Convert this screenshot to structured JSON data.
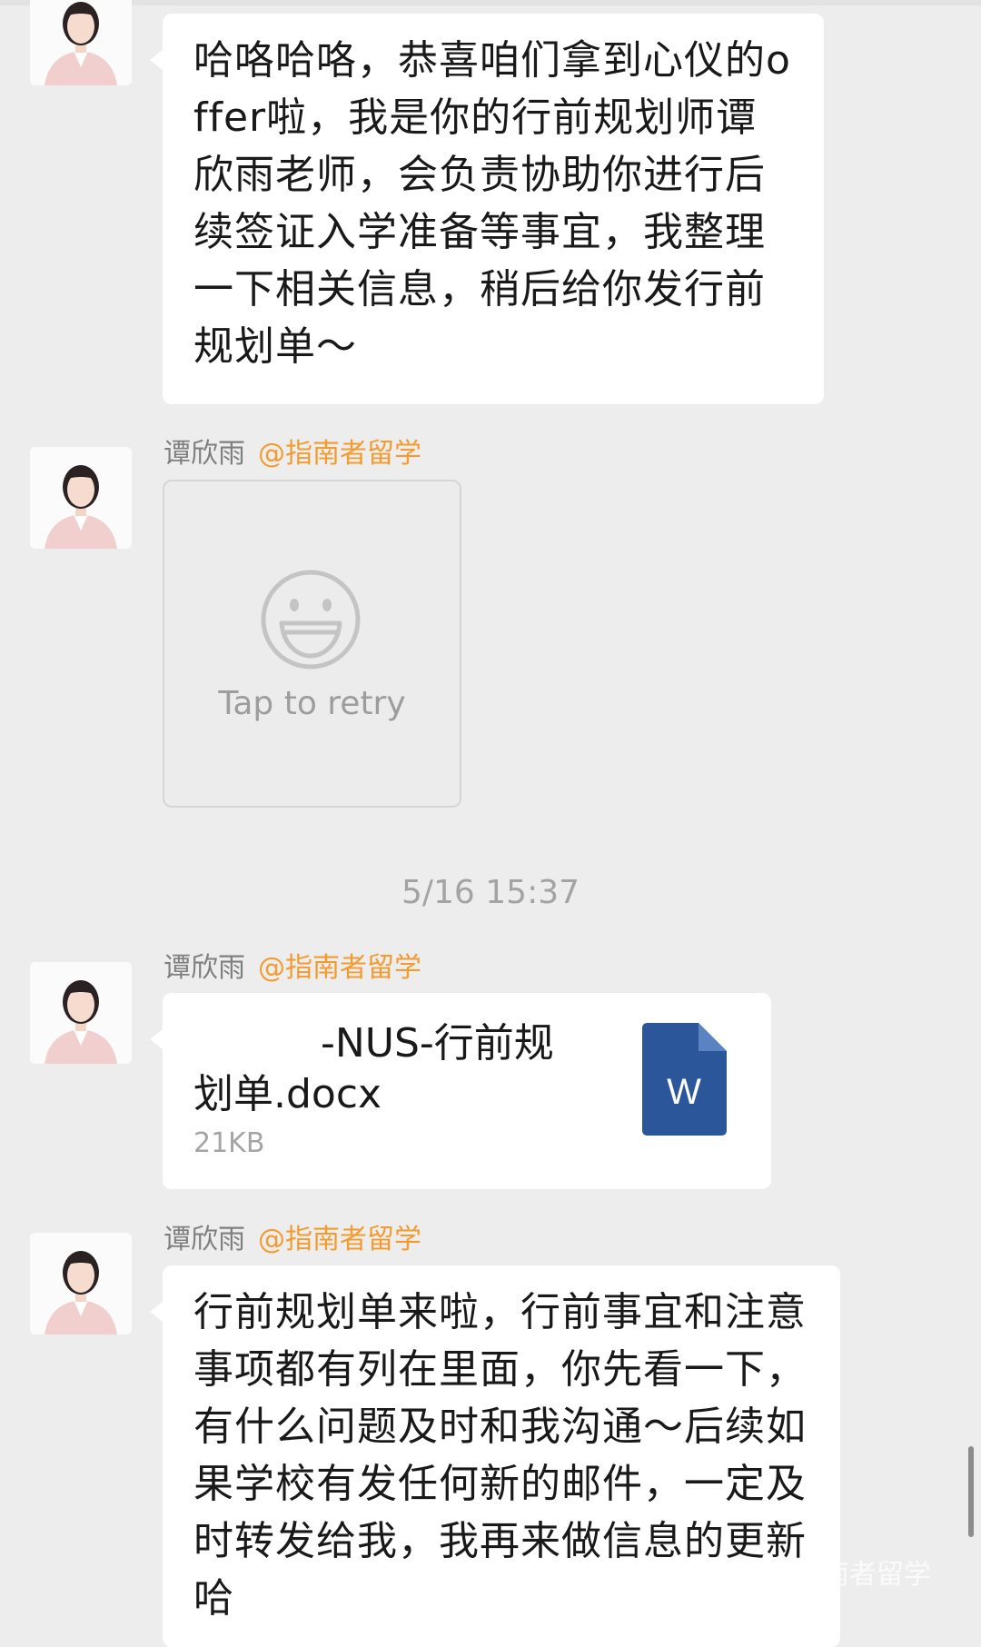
{
  "messages": [
    {
      "sender": "谭欣雨",
      "org": "@指南者留学",
      "text": "哈咯哈咯，恭喜咱们拿到心仪的offer啦，我是你的行前规划师谭欣雨老师，会负责协助你进行后续签证入学准备等事宜，我整理一下相关信息，稍后给你发行前规划单～"
    },
    {
      "sender": "谭欣雨",
      "org": "@指南者留学",
      "image_failed": {
        "icon": "smiley-face-icon",
        "label": "Tap to retry"
      }
    },
    {
      "timestamp": "5/16 15:37"
    },
    {
      "sender": "谭欣雨",
      "org": "@指南者留学",
      "file": {
        "name": "-NUS-行前规划单.docx",
        "size": "21KB",
        "icon": "word-doc-icon",
        "icon_letter": "W"
      }
    },
    {
      "sender": "谭欣雨",
      "org": "@指南者留学",
      "text": "行前规划单来啦，行前事宜和注意事项都有列在里面，你先看一下，有什么问题及时和我沟通～后续如果学校有发任何新的邮件，一定及时转发给我，我再来做信息的更新哈"
    }
  ],
  "watermark": "南者留学",
  "colors": {
    "background": "#ededed",
    "bubble": "#ffffff",
    "org_tag": "#f39b2f",
    "word_icon": "#2b579a"
  }
}
